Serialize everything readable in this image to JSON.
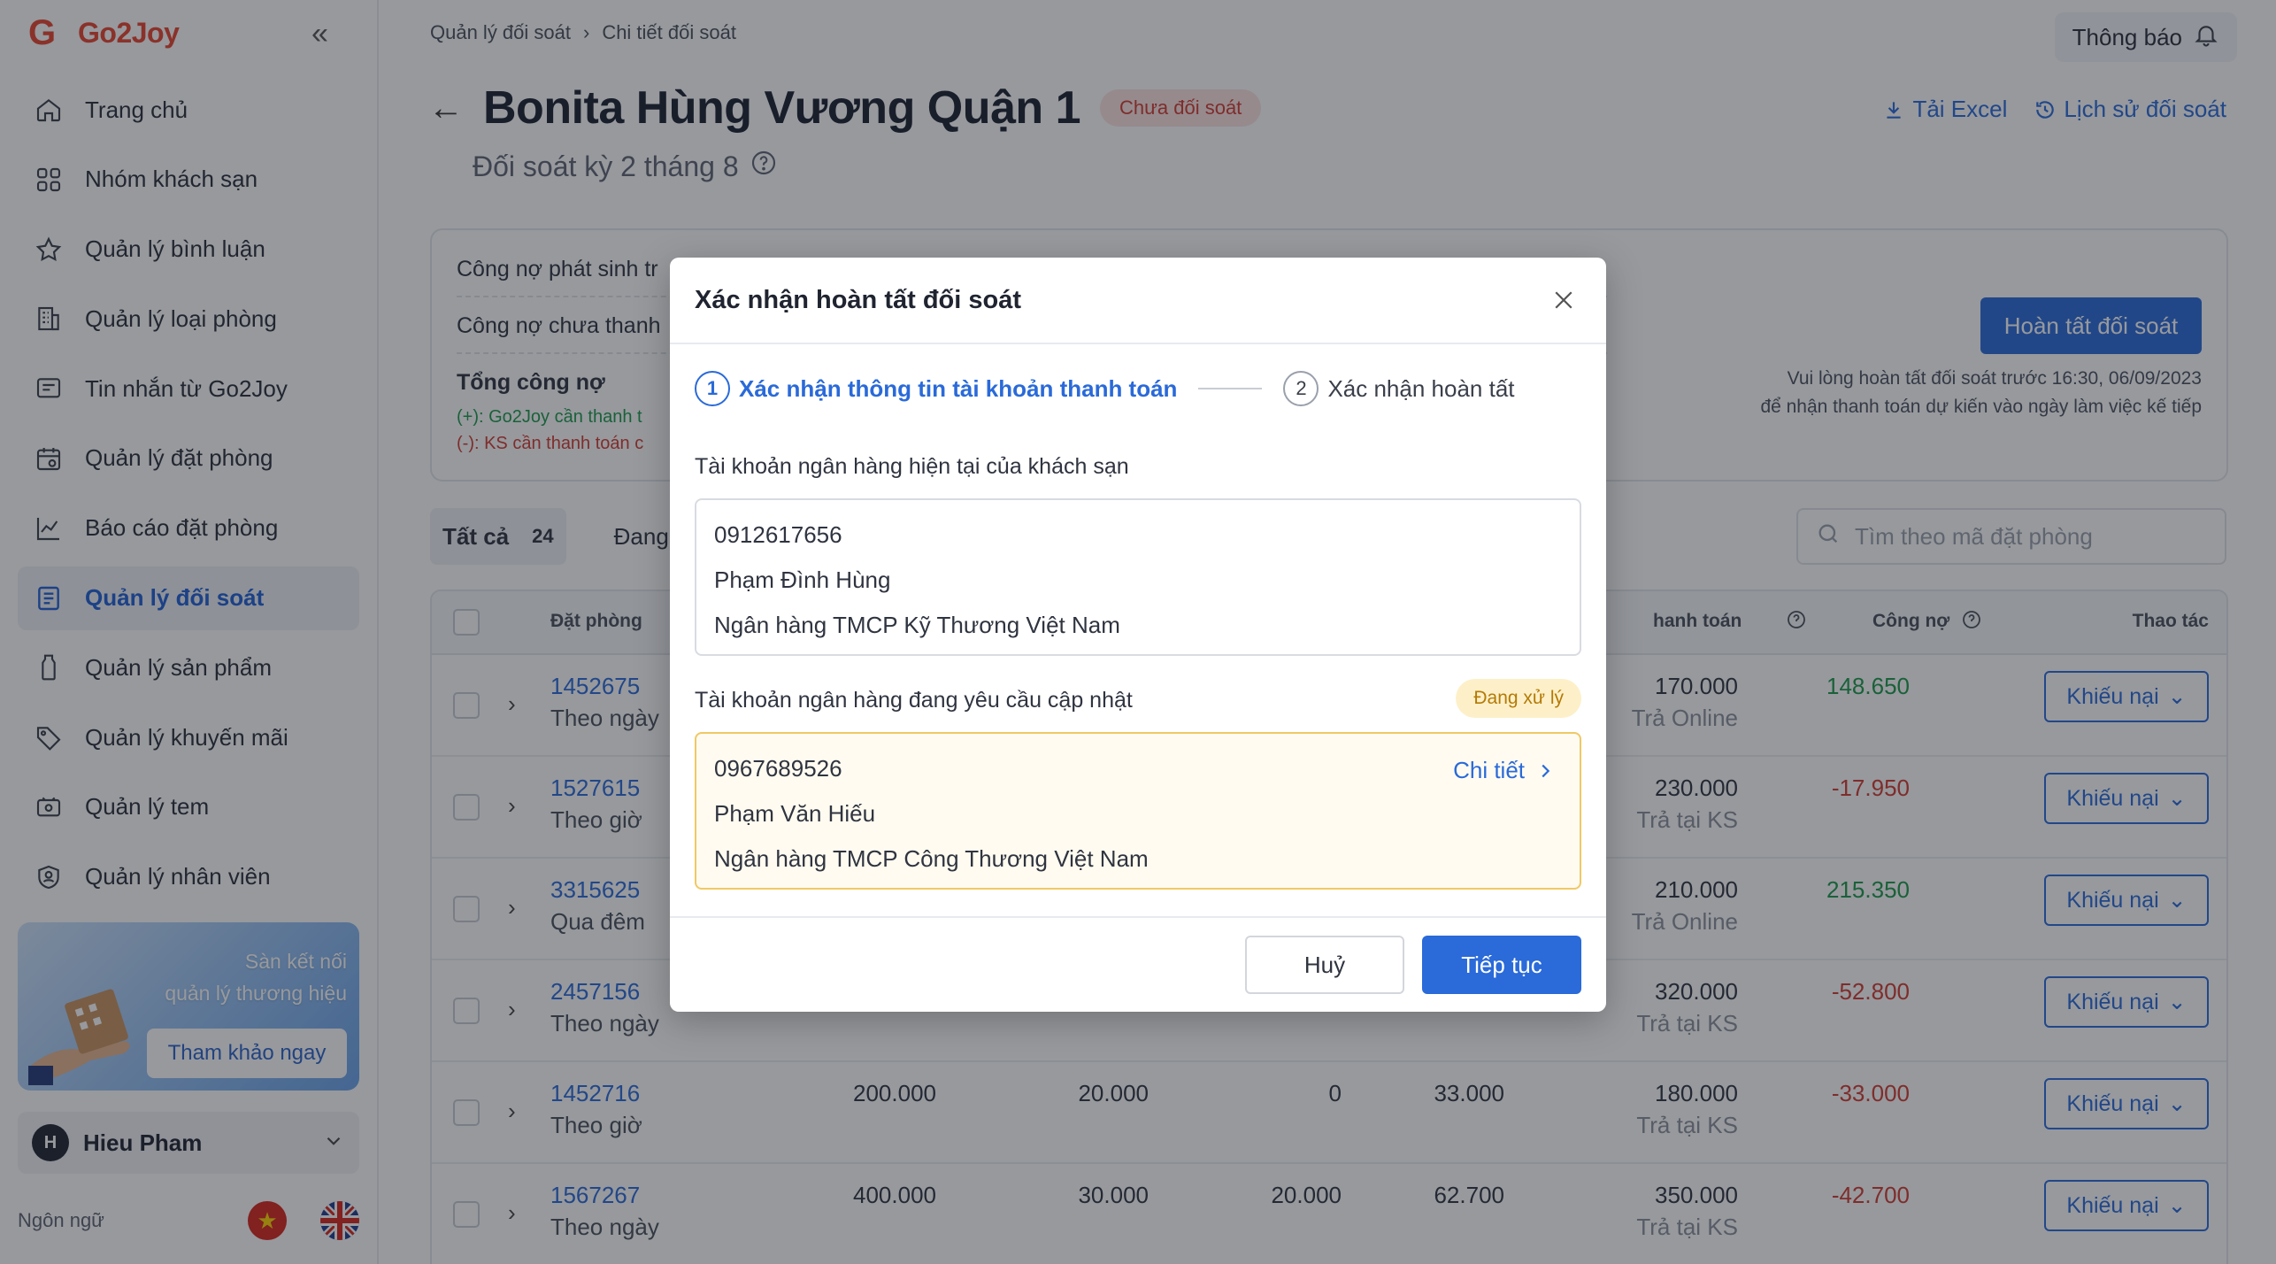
{
  "app": {
    "logo_text": "Go2Joy",
    "logo_mark": "G",
    "collapse_glyph": "«"
  },
  "sidebar": {
    "items": [
      {
        "label": "Trang chủ",
        "icon": "home-icon"
      },
      {
        "label": "Nhóm khách sạn",
        "icon": "grid-icon"
      },
      {
        "label": "Quản lý bình luận",
        "icon": "star-icon"
      },
      {
        "label": "Quản lý loại phòng",
        "icon": "building-icon"
      },
      {
        "label": "Tin nhắn từ Go2Joy",
        "icon": "message-icon"
      },
      {
        "label": "Quản lý đặt phòng",
        "icon": "calendar-icon"
      },
      {
        "label": "Báo cáo đặt phòng",
        "icon": "chart-line-icon"
      },
      {
        "label": "Quản lý đối soát",
        "icon": "document-icon",
        "active": true
      },
      {
        "label": "Quản lý sản phẩm",
        "icon": "bottle-icon"
      },
      {
        "label": "Quản lý khuyến mãi",
        "icon": "tag-icon"
      },
      {
        "label": "Quản lý tem",
        "icon": "ticket-icon"
      },
      {
        "label": "Quản lý nhân viên",
        "icon": "user-shield-icon"
      }
    ],
    "promo": {
      "line1": "Sàn kết nối",
      "line2": "quản lý thương hiệu",
      "button": "Tham khảo ngay"
    },
    "user": {
      "initial": "H",
      "name": "Hieu Pham"
    },
    "language_label": "Ngôn ngữ"
  },
  "header": {
    "breadcrumb": [
      "Quản lý đối soát",
      "Chi tiết đối soát"
    ],
    "notification": "Thông báo"
  },
  "page": {
    "title": "Bonita Hùng Vương Quận 1",
    "status": "Chưa đối soát",
    "subtitle": "Đối soát kỳ 2 tháng 8",
    "export_excel": "Tải Excel",
    "history": "Lịch sử đối soát"
  },
  "summary": {
    "row1": "Công nợ phát sinh tr",
    "row2": "Công nợ chưa thanh",
    "total_label": "Tổng công nợ",
    "plus_note": "(+): Go2Joy cần thanh t",
    "minus_note": "(-): KS cần thanh toán c",
    "finish_button": "Hoàn tất đối soát",
    "note_line1": "Vui lòng hoàn tất đối soát trước 16:30, 06/09/2023",
    "note_line2": "để nhận thanh toán dự kiến vào ngày làm việc kế tiếp"
  },
  "tabs": [
    {
      "label": "Tất cả",
      "count": "24"
    },
    {
      "label": "Đang",
      "count": ""
    }
  ],
  "search": {
    "placeholder": "Tìm theo mã đặt phòng"
  },
  "table": {
    "headers": {
      "booking": "Đặt phòng",
      "payment": "hanh toán",
      "debt": "Công nợ",
      "actions": "Thao tác"
    },
    "rows": [
      {
        "code": "1452675",
        "type": "Theo ngày",
        "c1": "",
        "c2": "",
        "c3": "",
        "c4": "",
        "pay": "170.000",
        "method": "Trả Online",
        "debt": "148.650",
        "sign": "pos"
      },
      {
        "code": "1527615",
        "type": "Theo giờ",
        "c1": "",
        "c2": "",
        "c3": "",
        "c4": "",
        "pay": "230.000",
        "method": "Trả tại KS",
        "debt": "-17.950",
        "sign": "neg"
      },
      {
        "code": "3315625",
        "type": "Qua đêm",
        "c1": "",
        "c2": "",
        "c3": "",
        "c4": "",
        "pay": "210.000",
        "method": "Trả Online",
        "debt": "215.350",
        "sign": "pos"
      },
      {
        "code": "2457156",
        "type": "Theo ngày",
        "c1": "",
        "c2": "",
        "c3": "",
        "c4": "",
        "pay": "320.000",
        "method": "Trả tại KS",
        "debt": "-52.800",
        "sign": "neg"
      },
      {
        "code": "1452716",
        "type": "Theo giờ",
        "c1": "200.000",
        "c2": "20.000",
        "c3": "0",
        "c4": "33.000",
        "pay": "180.000",
        "method": "Trả tại KS",
        "debt": "-33.000",
        "sign": "neg"
      },
      {
        "code": "1567267",
        "type": "Theo ngày",
        "c1": "400.000",
        "c2": "30.000",
        "c3": "20.000",
        "c4": "62.700",
        "pay": "350.000",
        "method": "Trả tại KS",
        "debt": "-42.700",
        "sign": "neg"
      }
    ],
    "complain_label": "Khiếu nại"
  },
  "modal": {
    "title": "Xác nhận hoàn tất đối soát",
    "step1_num": "1",
    "step1": "Xác nhận thông tin tài khoản thanh toán",
    "step2_num": "2",
    "step2": "Xác nhận hoàn tất",
    "current_label": "Tài khoản ngân hàng hiện tại của khách sạn",
    "current": {
      "account": "0912617656",
      "holder": "Phạm Đình Hùng",
      "bank": "Ngân hàng TMCP Kỹ Thương Việt Nam"
    },
    "pending_label": "Tài khoản ngân hàng đang yêu cầu cập nhật",
    "pending_status": "Đang xử lý",
    "pending": {
      "account": "0967689526",
      "holder": "Phạm Văn Hiếu",
      "bank": "Ngân hàng TMCP Công Thương Việt Nam"
    },
    "detail_link": "Chi tiết",
    "cancel": "Huỷ",
    "continue": "Tiếp tục"
  },
  "colors": {
    "primary": "#2a6ad9",
    "danger": "#d23b31",
    "success": "#1c9a4a",
    "warning_bg": "#fffbf0",
    "brand": "#e8442e"
  }
}
